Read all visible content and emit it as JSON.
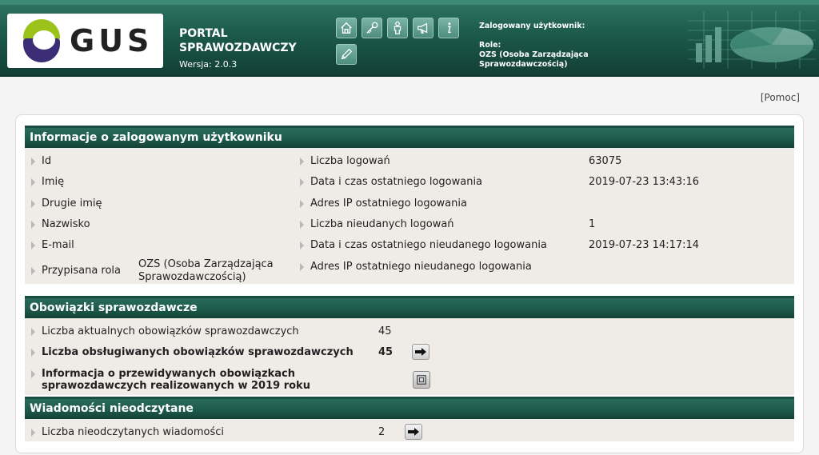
{
  "header": {
    "logo_text": "GUS",
    "portal_title": "PORTAL SPRAWOZDAWCZY",
    "version": "Wersja: 2.0.3",
    "tools": [
      {
        "icon": "home-icon"
      },
      {
        "icon": "key-icon"
      },
      {
        "icon": "user-icon"
      },
      {
        "icon": "megaphone-icon"
      },
      {
        "icon": "info-icon"
      },
      {
        "icon": "pencil-icon"
      }
    ],
    "logged_user_label": "Zalogowany użytkownik:",
    "role_label": "Role:",
    "role_value": "OZS (Osoba Zarządzająca Sprawozdawczością)"
  },
  "help_link": "[Pomoc]",
  "user_section": {
    "title": "Informacje o zalogowanym użytkowniku",
    "left": [
      {
        "label": "Id",
        "value": ""
      },
      {
        "label": "Imię",
        "value": ""
      },
      {
        "label": "Drugie imię",
        "value": ""
      },
      {
        "label": "Nazwisko",
        "value": ""
      },
      {
        "label": "E-mail",
        "value": ""
      },
      {
        "label": "Przypisana rola",
        "value_line1": "OZS (Osoba Zarządzająca",
        "value_line2": "Sprawozdawczością)"
      }
    ],
    "right": [
      {
        "label": "Liczba logowań",
        "value": "63075"
      },
      {
        "label": "Data i czas ostatniego logowania",
        "value": "2019-07-23 13:43:16"
      },
      {
        "label": "Adres IP ostatniego logowania",
        "value": ""
      },
      {
        "label": "Liczba nieudanych logowań",
        "value": "1"
      },
      {
        "label": "Data i czas ostatniego nieudanego logowania",
        "value": "2019-07-23 14:17:14"
      },
      {
        "label": "Adres IP ostatniego nieudanego logowania",
        "value": ""
      }
    ]
  },
  "duties_section": {
    "title": "Obowiązki sprawozdawcze",
    "rows": [
      {
        "label": "Liczba aktualnych obowiązków sprawozdawczych",
        "value": "45"
      },
      {
        "label": "Liczba obsługiwanych obowiązków sprawozdawczych",
        "value": "45"
      },
      {
        "label_line1": "Informacja o przewidywanych obowiązkach",
        "label_line2": "sprawozdawczych realizowanych w 2019 roku"
      }
    ]
  },
  "messages_section": {
    "title": "Wiadomości nieodczytane",
    "rows": [
      {
        "label": "Liczba nieodczytanych wiadomości",
        "value": "2"
      }
    ]
  }
}
